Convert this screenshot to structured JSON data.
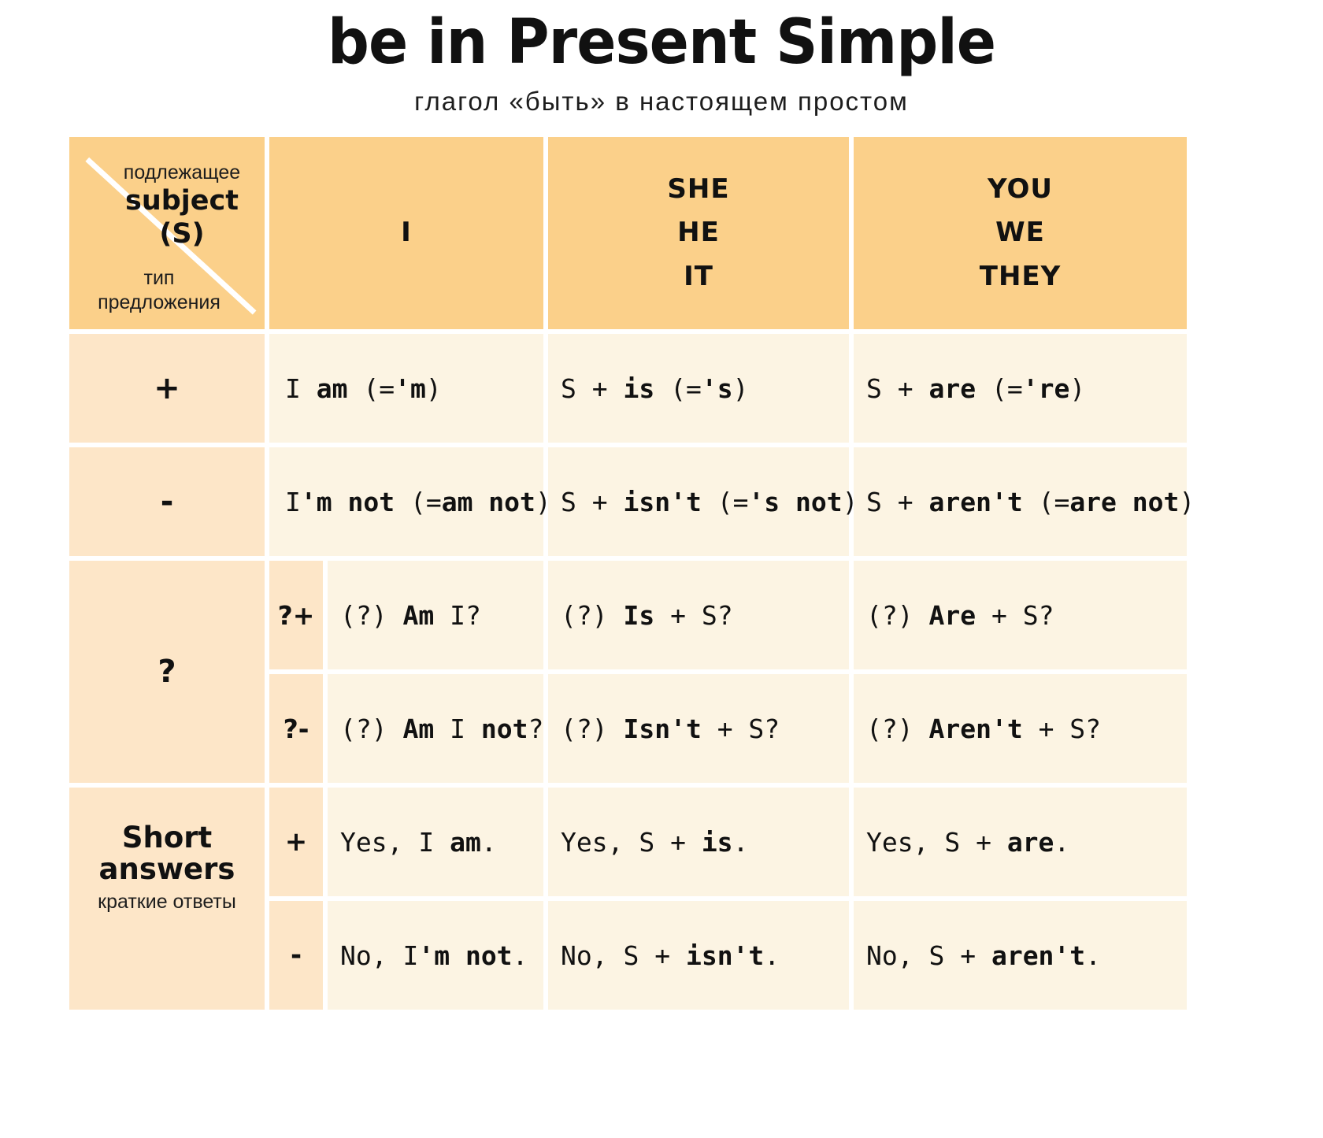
{
  "title": {
    "main": "be in Present Simple",
    "sub": "глагол «быть» в настоящем простом"
  },
  "colors": {
    "header_bg": "#fbd08a",
    "row_label_bg": "#fde6c8",
    "cell_bg": "#fcf4e3",
    "page_bg": "#ffffff",
    "text": "#111111"
  },
  "corner": {
    "subject_ru": "подлежащее",
    "subject_en": "subject",
    "subject_abbr": "(S)",
    "type_ru_1": "тип",
    "type_ru_2": "предложения"
  },
  "columns": [
    {
      "id": "i",
      "lines": [
        "I"
      ]
    },
    {
      "id": "she_he_it",
      "lines": [
        "SHE",
        "HE",
        "IT"
      ]
    },
    {
      "id": "you_we_they",
      "lines": [
        "YOU",
        "WE",
        "THEY"
      ]
    }
  ],
  "rows": [
    {
      "id": "positive",
      "label": "+",
      "label_kind": "sign",
      "subsign": null,
      "cells": [
        {
          "plain_1": "I ",
          "bold_1": "am",
          "plain_2": " (=",
          "bold_2": "'m",
          "plain_3": ")"
        },
        {
          "plain_1": "S + ",
          "bold_1": "is",
          "plain_2": " (=",
          "bold_2": "'s",
          "plain_3": ")"
        },
        {
          "plain_1": "S + ",
          "bold_1": "are",
          "plain_2": " (=",
          "bold_2": "'re",
          "plain_3": ")"
        }
      ],
      "texts": [
        "I am (='m)",
        "S + is (='s)",
        "S + are (='re)"
      ]
    },
    {
      "id": "negative",
      "label": "-",
      "label_kind": "sign",
      "subsign": null,
      "cells": [
        {
          "plain_1": "I",
          "bold_1": "'m not",
          "plain_2": " (=",
          "bold_2": "am not",
          "plain_3": ")"
        },
        {
          "plain_1": "S + ",
          "bold_1": "isn't",
          "plain_2": " (=",
          "bold_2": "'s not",
          "plain_3": ")"
        },
        {
          "plain_1": "S + ",
          "bold_1": "aren't",
          "plain_2": " (=",
          "bold_2": "are not",
          "plain_3": ")"
        }
      ],
      "texts": [
        "I'm not (=am not)",
        "S + isn't (='s not)",
        "S + aren't (=are not)"
      ]
    },
    {
      "id": "question_positive",
      "label": "?",
      "label_kind": "question-span",
      "subsign": "?+",
      "cells": [
        {
          "plain_1": "(?) ",
          "bold_1": "Am",
          "plain_2": " I?",
          "bold_2": "",
          "plain_3": ""
        },
        {
          "plain_1": "(?) ",
          "bold_1": "Is",
          "plain_2": " + S?",
          "bold_2": "",
          "plain_3": ""
        },
        {
          "plain_1": "(?) ",
          "bold_1": "Are",
          "plain_2": " + S?",
          "bold_2": "",
          "plain_3": ""
        }
      ],
      "texts": [
        "(?) Am I?",
        "(?) Is + S?",
        "(?) Are + S?"
      ]
    },
    {
      "id": "question_negative",
      "label": "",
      "label_kind": "none",
      "subsign": "?-",
      "cells": [
        {
          "plain_1": "(?) ",
          "bold_1": "Am",
          "plain_2": " I ",
          "bold_2": "not",
          "plain_3": "?"
        },
        {
          "plain_1": "(?) ",
          "bold_1": "Isn't",
          "plain_2": " + S?",
          "bold_2": "",
          "plain_3": ""
        },
        {
          "plain_1": "(?) ",
          "bold_1": "Aren't",
          "plain_2": " + S?",
          "bold_2": "",
          "plain_3": ""
        }
      ],
      "texts": [
        "(?) Am I not?",
        "(?) Isn't + S?",
        "(?) Aren't + S?"
      ]
    },
    {
      "id": "short_answer_positive",
      "label_en": "Short answers",
      "label_ru": "краткие ответы",
      "label_kind": "short-span",
      "subsign": "+",
      "cells": [
        {
          "plain_1": "Yes, I ",
          "bold_1": "am",
          "plain_2": ".",
          "bold_2": "",
          "plain_3": ""
        },
        {
          "plain_1": "Yes, S + ",
          "bold_1": "is",
          "plain_2": ".",
          "bold_2": "",
          "plain_3": ""
        },
        {
          "plain_1": "Yes, S + ",
          "bold_1": "are",
          "plain_2": ".",
          "bold_2": "",
          "plain_3": ""
        }
      ],
      "texts": [
        "Yes, I am.",
        "Yes, S + is.",
        "Yes, S + are."
      ]
    },
    {
      "id": "short_answer_negative",
      "label": "",
      "label_kind": "none",
      "subsign": "-",
      "cells": [
        {
          "plain_1": "No, I",
          "bold_1": "'m not",
          "plain_2": ".",
          "bold_2": "",
          "plain_3": ""
        },
        {
          "plain_1": "No, S + ",
          "bold_1": "isn't",
          "plain_2": ".",
          "bold_2": "",
          "plain_3": ""
        },
        {
          "plain_1": "No, S + ",
          "bold_1": "aren't",
          "plain_2": ".",
          "bold_2": "",
          "plain_3": ""
        }
      ],
      "texts": [
        "No, I'm not.",
        "No, S + isn't.",
        "No, S + aren't."
      ]
    }
  ]
}
